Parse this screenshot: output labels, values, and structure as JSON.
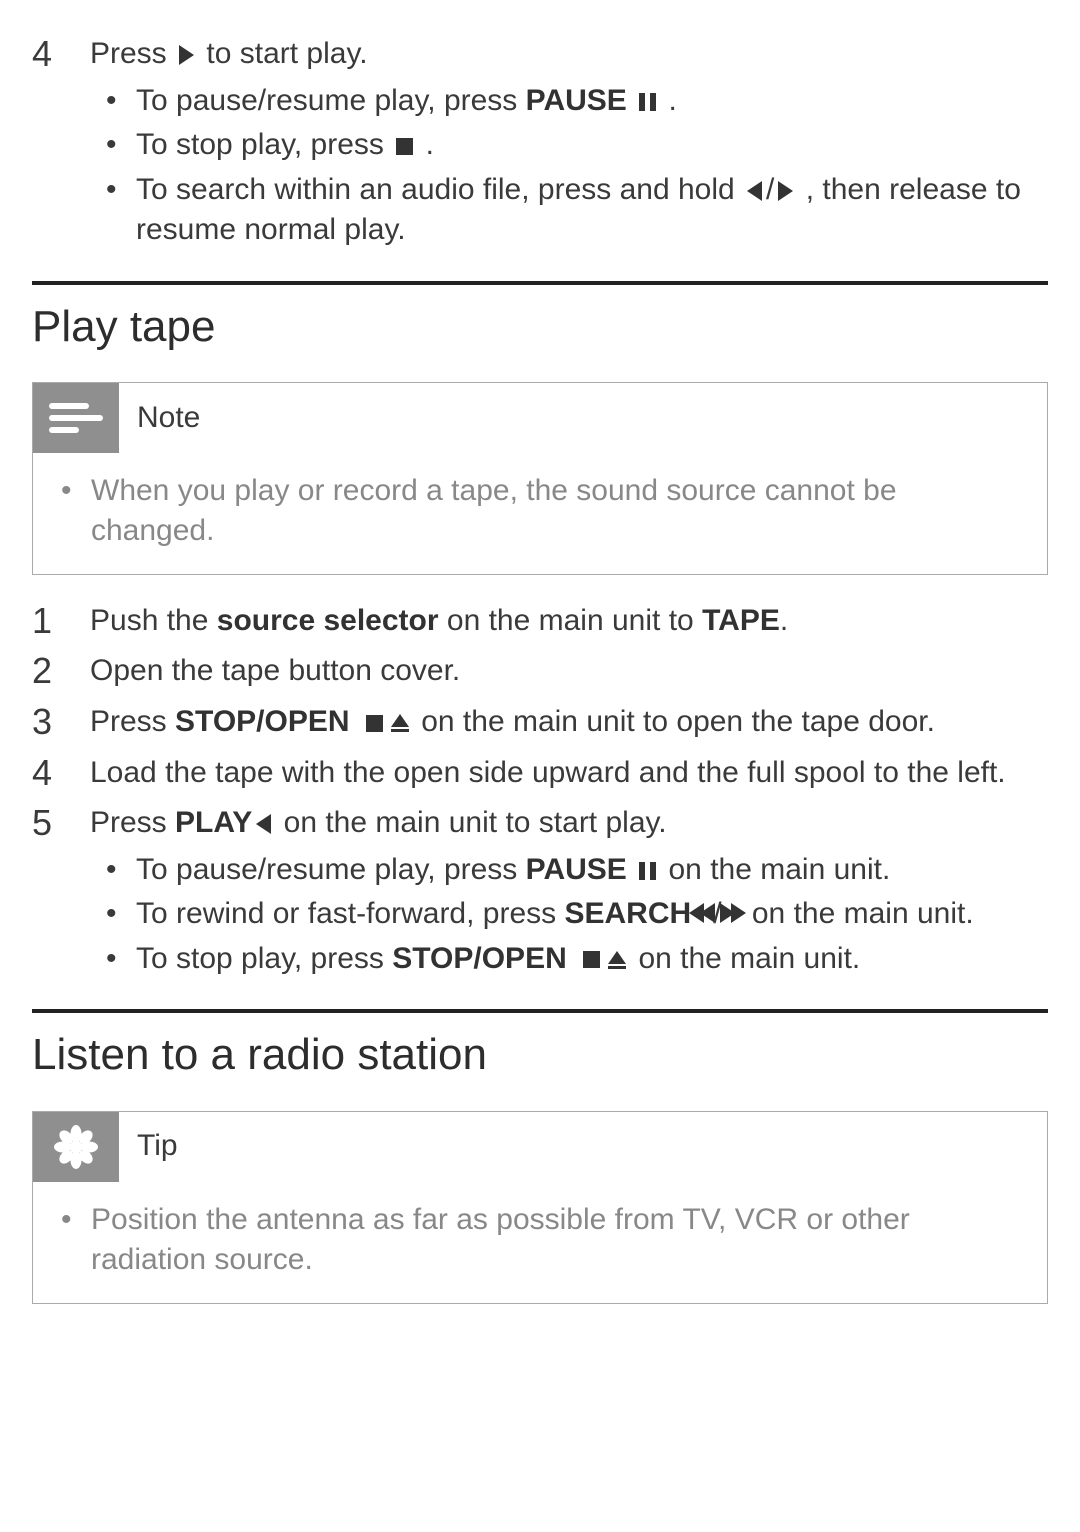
{
  "step4_top": {
    "num": "4",
    "lead_a": "Press",
    "lead_b": "to start play.",
    "bullets": [
      {
        "a": "To pause/resume play, press",
        "b": "PAUSE",
        "c": "."
      },
      {
        "a": "To stop play, press",
        "b": "",
        "c": "."
      },
      {
        "a": "To search within an audio file, press and hold",
        "b": "",
        "c": ", then release to resume normal play."
      }
    ]
  },
  "section_play_tape": "Play tape",
  "note": {
    "title": "Note",
    "body": "When you play or record a tape, the sound source cannot be changed."
  },
  "tape_steps": [
    {
      "num": "1",
      "a": "Push the",
      "b": "source selector",
      "c": "on the main unit to",
      "d": "TAPE",
      "e": "."
    },
    {
      "num": "2",
      "a": "Open the tape button cover."
    },
    {
      "num": "3",
      "a": "Press",
      "b": "STOP/OPEN",
      "c": "on the main unit to open the tape door."
    },
    {
      "num": "4",
      "a": "Load the tape with the open side upward and the full spool to the left."
    },
    {
      "num": "5",
      "a": "Press",
      "b": "PLAY",
      "c": "on the main unit to start play.",
      "bullets": [
        {
          "a": "To pause/resume play, press",
          "b": "PAUSE",
          "c": "on the main unit."
        },
        {
          "a": "To rewind or fast-forward, press",
          "b": "SEARCH",
          "c": "on the main unit."
        },
        {
          "a": "To stop play, press",
          "b": "STOP/OPEN",
          "c": "on the main unit."
        }
      ]
    }
  ],
  "section_radio": "Listen to a radio station",
  "tip": {
    "title": "Tip",
    "body": "Position the antenna as far as possible from TV, VCR or other radiation source."
  }
}
